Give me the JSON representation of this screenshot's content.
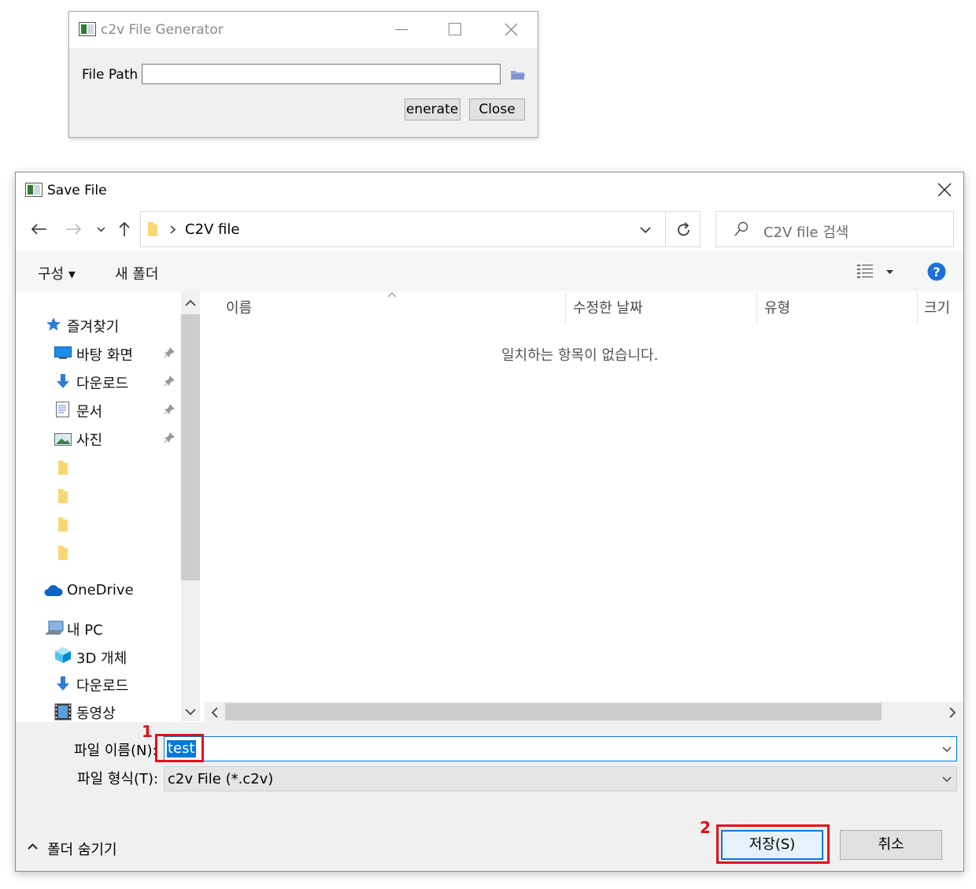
{
  "generator": {
    "title": "c2v File Generator",
    "file_path_label": "File Path",
    "file_path_value": "",
    "generate_label": "Generate",
    "close_label": "Close"
  },
  "dialog": {
    "title": "Save File",
    "breadcrumb": "C2V file",
    "search_placeholder": "C2V file 검색",
    "toolbar": {
      "organize": "구성 ▾",
      "new_folder": "새 폴더"
    },
    "nav": {
      "quick_access": "즐겨찾기",
      "pinned": [
        "바탕 화면",
        "다운로드",
        "문서",
        "사진"
      ],
      "onedrive": "OneDrive",
      "this_pc": "내 PC",
      "pc_items": [
        "3D 개체",
        "다운로드",
        "동영상"
      ]
    },
    "columns": [
      "이름",
      "수정한 날짜",
      "유형",
      "크기"
    ],
    "empty_message": "일치하는 항목이 없습니다.",
    "file_name_label": "파일 이름(N):",
    "file_name_value": "test",
    "file_type_label": "파일 형식(T):",
    "file_type_value": "c2v File (*.c2v)",
    "hide_folders": "폴더 숨기기",
    "save_label": "저장(S)",
    "cancel_label": "취소"
  },
  "annotations": [
    "1",
    "2"
  ],
  "colors": {
    "accent": "#0078d7",
    "annotation": "#e0101a",
    "folder": "#f8d775",
    "help": "#1e6fd9"
  }
}
